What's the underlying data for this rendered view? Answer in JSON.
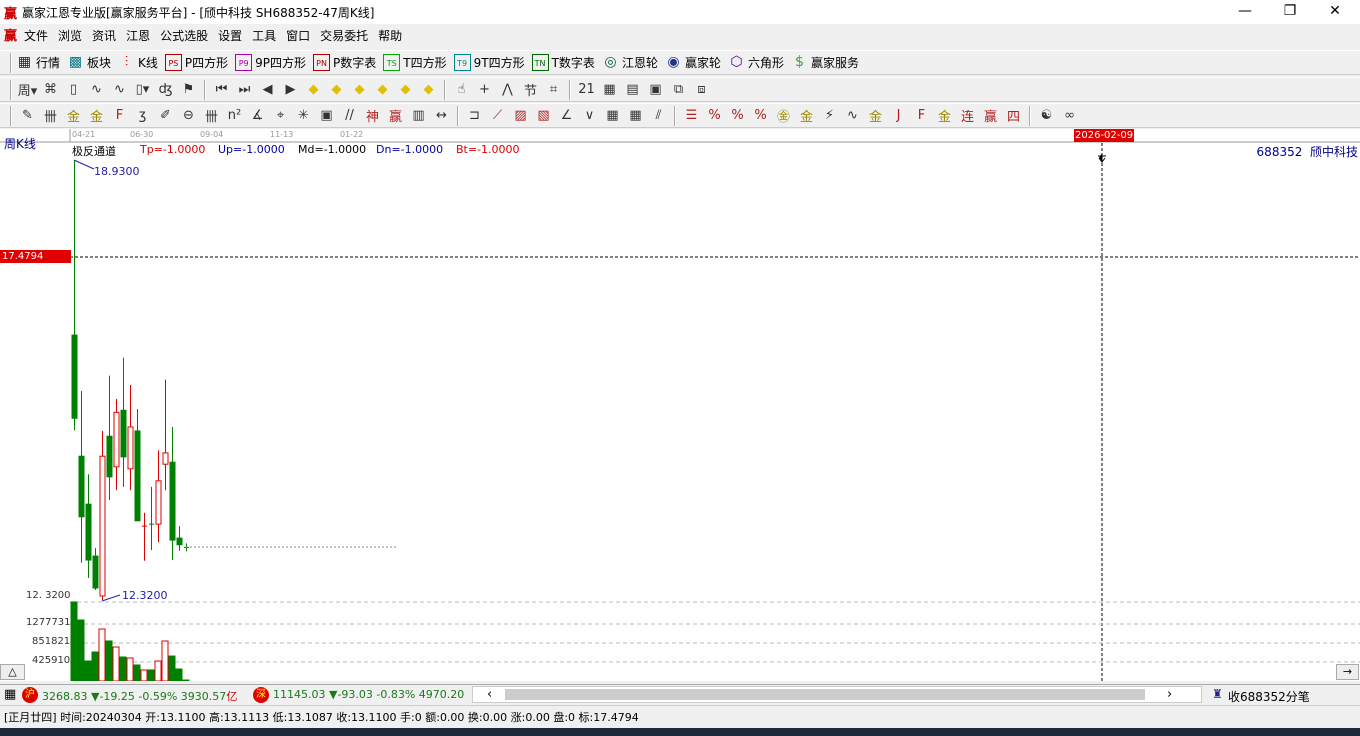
{
  "window": {
    "title": "赢家江恩专业版[赢家服务平台] - [颀中科技  SH688352-47周K线]",
    "logo": "赢",
    "minimize": "—",
    "restore": "❐",
    "close": "✕"
  },
  "menu": [
    "文件",
    "浏览",
    "资讯",
    "江恩",
    "公式选股",
    "设置",
    "工具",
    "窗口",
    "交易委托",
    "帮助"
  ],
  "toolbar1": [
    {
      "label": "行情",
      "icon": "table-icon",
      "glyph": "▦",
      "color": "#223"
    },
    {
      "label": "板块",
      "icon": "blocks-icon",
      "glyph": "▩",
      "color": "#0a7a8a"
    },
    {
      "label": "K线",
      "icon": "candlestick-icon",
      "glyph": "⫶",
      "color": "#c00"
    },
    {
      "label": "P四方形",
      "icon": "ps-icon",
      "glyph": "PS",
      "color": "#a00"
    },
    {
      "label": "9P四方形",
      "icon": "p9-icon",
      "glyph": "P9",
      "color": "#a0a"
    },
    {
      "label": "P数字表",
      "icon": "pn-icon",
      "glyph": "PN",
      "color": "#a00"
    },
    {
      "label": "T四方形",
      "icon": "ts-icon",
      "glyph": "TS",
      "color": "#0a0"
    },
    {
      "label": "9T四方形",
      "icon": "t9-icon",
      "glyph": "T9",
      "color": "#088"
    },
    {
      "label": "T数字表",
      "icon": "tn-icon",
      "glyph": "TN",
      "color": "#060"
    },
    {
      "label": "江恩轮",
      "icon": "gann-wheel-icon",
      "glyph": "◎",
      "color": "#063"
    },
    {
      "label": "赢家轮",
      "icon": "winner-wheel-icon",
      "glyph": "◉",
      "color": "#238"
    },
    {
      "label": "六角形",
      "icon": "hexagon-icon",
      "glyph": "⬡",
      "color": "#508"
    },
    {
      "label": "赢家服务",
      "icon": "dollar-icon",
      "glyph": "$",
      "color": "#3a3"
    }
  ],
  "toolbar2": [
    {
      "icon": "period-icon",
      "glyph": "周▾"
    },
    {
      "icon": "pattern-icon",
      "glyph": "⌘"
    },
    {
      "icon": "doc-icon",
      "glyph": "▯"
    },
    {
      "icon": "wave3-icon",
      "glyph": "∿"
    },
    {
      "icon": "wave9-icon",
      "glyph": "∿"
    },
    {
      "icon": "candle-type-icon",
      "glyph": "▯▾"
    },
    {
      "icon": "draw-icon",
      "glyph": "ʤ"
    },
    {
      "icon": "flag-icon",
      "glyph": "⚑"
    },
    {
      "icon": "first-icon",
      "glyph": "⏮"
    },
    {
      "icon": "last-icon",
      "glyph": "⏭"
    },
    {
      "icon": "left-icon",
      "glyph": "◀"
    },
    {
      "icon": "right-icon",
      "glyph": "▶"
    },
    {
      "icon": "diamond-left-icon",
      "glyph": "◆"
    },
    {
      "icon": "diamond-right-icon",
      "glyph": "◆"
    },
    {
      "icon": "diamond-expand-icon",
      "glyph": "◆"
    },
    {
      "icon": "diamond-shrink-icon",
      "glyph": "◆"
    },
    {
      "icon": "diamond-all-icon",
      "glyph": "◆"
    },
    {
      "icon": "diamond-updown-icon",
      "glyph": "◆"
    },
    {
      "icon": "hand-icon",
      "glyph": "☝"
    },
    {
      "icon": "crosshair-icon",
      "glyph": "+"
    },
    {
      "icon": "line-icon",
      "glyph": "⋀"
    },
    {
      "icon": "knot-icon",
      "glyph": "节"
    },
    {
      "icon": "pattern2-icon",
      "glyph": "⌗"
    },
    {
      "icon": "calendar-icon",
      "glyph": "21"
    },
    {
      "icon": "calculator-icon",
      "glyph": "▦"
    },
    {
      "icon": "notes-icon",
      "glyph": "▤"
    },
    {
      "icon": "save-icon",
      "glyph": "▣"
    },
    {
      "icon": "network-icon",
      "glyph": "⧉"
    },
    {
      "icon": "export-icon",
      "glyph": "⧈"
    }
  ],
  "toolbar3": [
    {
      "icon": "pen-icon",
      "glyph": "✎"
    },
    {
      "icon": "hash-icon",
      "glyph": "卌"
    },
    {
      "icon": "gold1-icon",
      "glyph": "金"
    },
    {
      "icon": "gold2-icon",
      "glyph": "金"
    },
    {
      "icon": "fib-icon",
      "glyph": "F"
    },
    {
      "icon": "spiral-icon",
      "glyph": "ʒ"
    },
    {
      "icon": "brush-icon",
      "glyph": "✐"
    },
    {
      "icon": "circle-ruler-icon",
      "glyph": "⊖"
    },
    {
      "icon": "lines-icon",
      "glyph": "卌"
    },
    {
      "icon": "n2-icon",
      "glyph": "n²"
    },
    {
      "icon": "angle-icon",
      "glyph": "∡"
    },
    {
      "icon": "target-icon",
      "glyph": "⌖"
    },
    {
      "icon": "star-icon",
      "glyph": "✳"
    },
    {
      "icon": "box-icon",
      "glyph": "▣"
    },
    {
      "icon": "ticks-icon",
      "glyph": "//"
    },
    {
      "icon": "god-icon",
      "glyph": "神"
    },
    {
      "icon": "win-icon",
      "glyph": "赢"
    },
    {
      "icon": "ruler-icon",
      "glyph": "▥"
    },
    {
      "icon": "measure-icon",
      "glyph": "↔"
    },
    {
      "icon": "rect-icon",
      "glyph": "⊐"
    },
    {
      "icon": "fan-icon",
      "glyph": "⟋"
    },
    {
      "icon": "grid-fan-icon",
      "glyph": "▨"
    },
    {
      "icon": "grid-fan2-icon",
      "glyph": "▧"
    },
    {
      "icon": "angle2-icon",
      "glyph": "∠"
    },
    {
      "icon": "v-icon",
      "glyph": "∨"
    },
    {
      "icon": "grid-icon",
      "glyph": "▦"
    },
    {
      "icon": "grid2-icon",
      "glyph": "▦"
    },
    {
      "icon": "parallel-icon",
      "glyph": "⫽"
    },
    {
      "icon": "percent-lines-icon",
      "glyph": "☰"
    },
    {
      "icon": "percent-fan-icon",
      "glyph": "%"
    },
    {
      "icon": "percent-icon",
      "glyph": "%"
    },
    {
      "icon": "percent-levels-icon",
      "glyph": "%"
    },
    {
      "icon": "gold-coin-icon",
      "glyph": "㊎"
    },
    {
      "icon": "gold-levels-icon",
      "glyph": "金"
    },
    {
      "icon": "rocket-icon",
      "glyph": "⚡"
    },
    {
      "icon": "sine-icon",
      "glyph": "∿"
    },
    {
      "icon": "gold-line-icon",
      "glyph": "金"
    },
    {
      "icon": "j-fan-icon",
      "glyph": "J"
    },
    {
      "icon": "f-fan-icon",
      "glyph": "F"
    },
    {
      "icon": "gold-fan-icon",
      "glyph": "金"
    },
    {
      "icon": "lian-fan-icon",
      "glyph": "连"
    },
    {
      "icon": "win-fan-icon",
      "glyph": "赢"
    },
    {
      "icon": "four-fan-icon",
      "glyph": "四"
    },
    {
      "icon": "yinyang-icon",
      "glyph": "☯"
    },
    {
      "icon": "infinity-icon",
      "glyph": "∞"
    }
  ],
  "chart": {
    "period_label": "周K线",
    "date_ticks": [
      "04-21",
      "06-30",
      "09-04",
      "11-13",
      "01-22"
    ],
    "cursor_date": "2026-02-09",
    "cursor_price": "17.4794",
    "stock": "688352  颀中科技",
    "indicator": {
      "name": "极反通道",
      "tp": "Tp=-1.0000",
      "up": "Up=-1.0000",
      "md": "Md=-1.0000",
      "dn": "Dn=-1.0000",
      "bt": "Bt=-1.0000"
    },
    "high_label": "18.9300",
    "low_label": "12.3200",
    "axis_low": "12. 3200",
    "vol_ticks": [
      "1277731",
      "851821",
      "425910"
    ],
    "scroll_up": "△",
    "scroll_right": "→"
  },
  "chart_data": {
    "type": "candlestick",
    "price_range": [
      12.32,
      18.93
    ],
    "ohlc": [
      [
        16.3,
        18.93,
        14.87,
        15.05
      ],
      [
        14.48,
        15.46,
        12.88,
        13.57
      ],
      [
        13.76,
        14.21,
        12.65,
        12.92
      ],
      [
        12.98,
        13.1,
        12.47,
        12.5
      ],
      [
        12.38,
        14.86,
        12.32,
        14.48
      ],
      [
        14.78,
        15.69,
        13.82,
        14.17
      ],
      [
        14.32,
        15.34,
        13.97,
        15.14
      ],
      [
        15.17,
        15.96,
        14.02,
        14.47
      ],
      [
        14.29,
        15.55,
        13.97,
        14.92
      ],
      [
        14.86,
        15.19,
        13.51,
        13.51
      ],
      [
        13.42,
        13.63,
        12.91,
        13.43
      ],
      [
        13.46,
        14.02,
        13.07,
        13.45
      ],
      [
        13.46,
        14.57,
        13.19,
        14.11
      ],
      [
        14.36,
        15.63,
        13.97,
        14.53
      ],
      [
        14.39,
        14.92,
        12.92,
        13.22
      ],
      [
        13.25,
        13.43,
        13.06,
        13.15
      ],
      [
        13.11,
        13.17,
        13.05,
        13.11
      ]
    ],
    "volume": [
      1771000,
      1367000,
      448000,
      650000,
      1166000,
      897000,
      762000,
      538000,
      516000,
      359000,
      247000,
      247000,
      448000,
      897000,
      560000,
      269000,
      22000
    ],
    "volume_max": 1277731,
    "up_color": "#e00000",
    "down_color": "#008000"
  },
  "status1": {
    "sh_badge": "沪",
    "sh": "3268.83 ▼-19.25 -0.59% 3930.57",
    "sh_unit": "亿",
    "sz_badge": "深",
    "sz": "11145.03 ▼-93.03 -0.83% 4970.20",
    "scroll_left": "‹",
    "scroll_right": "›",
    "feed": "收688352分笔"
  },
  "status2": {
    "text": "[正月廿四] 时间:20240304 开:13.1100 高:13.1113 低:13.1087 收:13.1100 手:0 额:0.00 换:0.00 涨:0.00 盘:0 标:17.4794"
  }
}
